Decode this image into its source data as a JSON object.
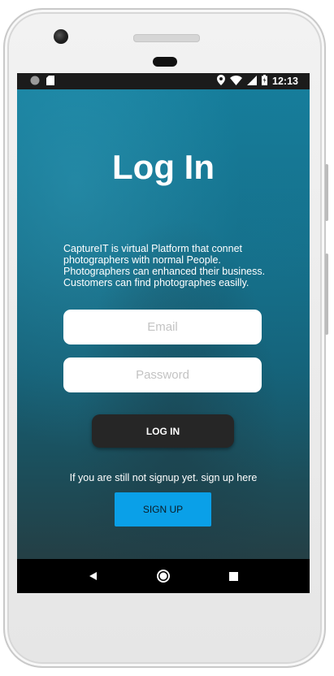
{
  "status_bar": {
    "time": "12:13",
    "icons": [
      "notification-dot-icon",
      "sd-card-icon",
      "location-icon",
      "wifi-icon",
      "signal-icon",
      "battery-icon"
    ]
  },
  "login": {
    "title": "Log In",
    "description": "CaptureIT is virtual Platform that connet photographers with normal People. Photographers can enhanced their business. Customers can find photographes easilly.",
    "email_placeholder": "Email",
    "email_value": "",
    "password_placeholder": "Password",
    "password_value": "",
    "login_button_label": "LOG IN",
    "signup_prompt": "If you are still not signup yet. sign up here",
    "signup_button_label": "SIGN UP"
  },
  "nav_bar": {
    "icons": [
      "back-icon",
      "home-icon",
      "recents-icon"
    ]
  },
  "colors": {
    "background_top": "#167e9c",
    "login_button": "#262626",
    "signup_button": "#0aa0e8",
    "input_background": "#ffffff"
  }
}
